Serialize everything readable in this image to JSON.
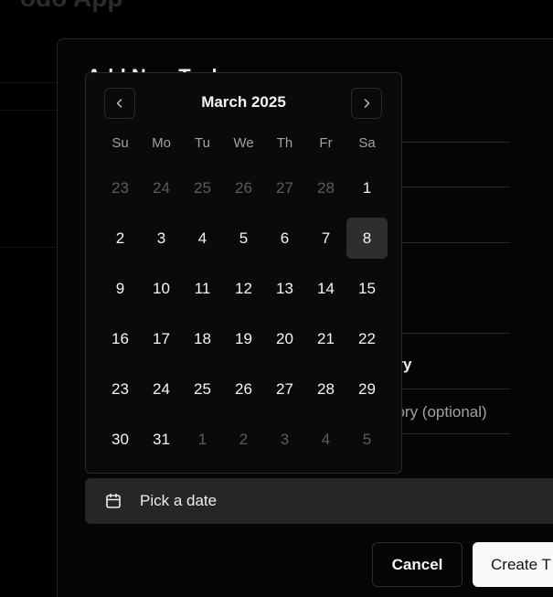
{
  "colors": {
    "background": "#000000",
    "dialog_bg": "#050505",
    "popover_bg": "#0a0a0a",
    "border": "#2a2a2a",
    "text_primary": "#f5f5f5",
    "text_muted": "#a1a1a1",
    "text_outside_day": "#5c5c5c",
    "selected_day_bg": "#2e2e2e",
    "primary_button_bg": "#fafafa"
  },
  "background_app": {
    "title": "odo App"
  },
  "dialog": {
    "title": "Add New Task",
    "category_label": "ory",
    "category_placeholder": "gory (optional)",
    "date_button": {
      "icon": "calendar-icon",
      "label": "Pick a date"
    },
    "cancel_label": "Cancel",
    "create_label": "Create T"
  },
  "calendar": {
    "month_label": "March 2025",
    "prev_icon": "chevron-left-icon",
    "next_icon": "chevron-right-icon",
    "weekdays": [
      "Su",
      "Mo",
      "Tu",
      "We",
      "Th",
      "Fr",
      "Sa"
    ],
    "selected_day": "8",
    "days": [
      {
        "label": "23",
        "outside": true
      },
      {
        "label": "24",
        "outside": true
      },
      {
        "label": "25",
        "outside": true
      },
      {
        "label": "26",
        "outside": true
      },
      {
        "label": "27",
        "outside": true
      },
      {
        "label": "28",
        "outside": true
      },
      {
        "label": "1",
        "outside": false
      },
      {
        "label": "2",
        "outside": false
      },
      {
        "label": "3",
        "outside": false
      },
      {
        "label": "4",
        "outside": false
      },
      {
        "label": "5",
        "outside": false
      },
      {
        "label": "6",
        "outside": false
      },
      {
        "label": "7",
        "outside": false
      },
      {
        "label": "8",
        "outside": false,
        "selected": true
      },
      {
        "label": "9",
        "outside": false
      },
      {
        "label": "10",
        "outside": false
      },
      {
        "label": "11",
        "outside": false
      },
      {
        "label": "12",
        "outside": false
      },
      {
        "label": "13",
        "outside": false
      },
      {
        "label": "14",
        "outside": false
      },
      {
        "label": "15",
        "outside": false
      },
      {
        "label": "16",
        "outside": false
      },
      {
        "label": "17",
        "outside": false
      },
      {
        "label": "18",
        "outside": false
      },
      {
        "label": "19",
        "outside": false
      },
      {
        "label": "20",
        "outside": false
      },
      {
        "label": "21",
        "outside": false
      },
      {
        "label": "22",
        "outside": false
      },
      {
        "label": "23",
        "outside": false
      },
      {
        "label": "24",
        "outside": false
      },
      {
        "label": "25",
        "outside": false
      },
      {
        "label": "26",
        "outside": false
      },
      {
        "label": "27",
        "outside": false
      },
      {
        "label": "28",
        "outside": false
      },
      {
        "label": "29",
        "outside": false
      },
      {
        "label": "30",
        "outside": false
      },
      {
        "label": "31",
        "outside": false
      },
      {
        "label": "1",
        "outside": true
      },
      {
        "label": "2",
        "outside": true
      },
      {
        "label": "3",
        "outside": true
      },
      {
        "label": "4",
        "outside": true
      },
      {
        "label": "5",
        "outside": true
      }
    ]
  }
}
